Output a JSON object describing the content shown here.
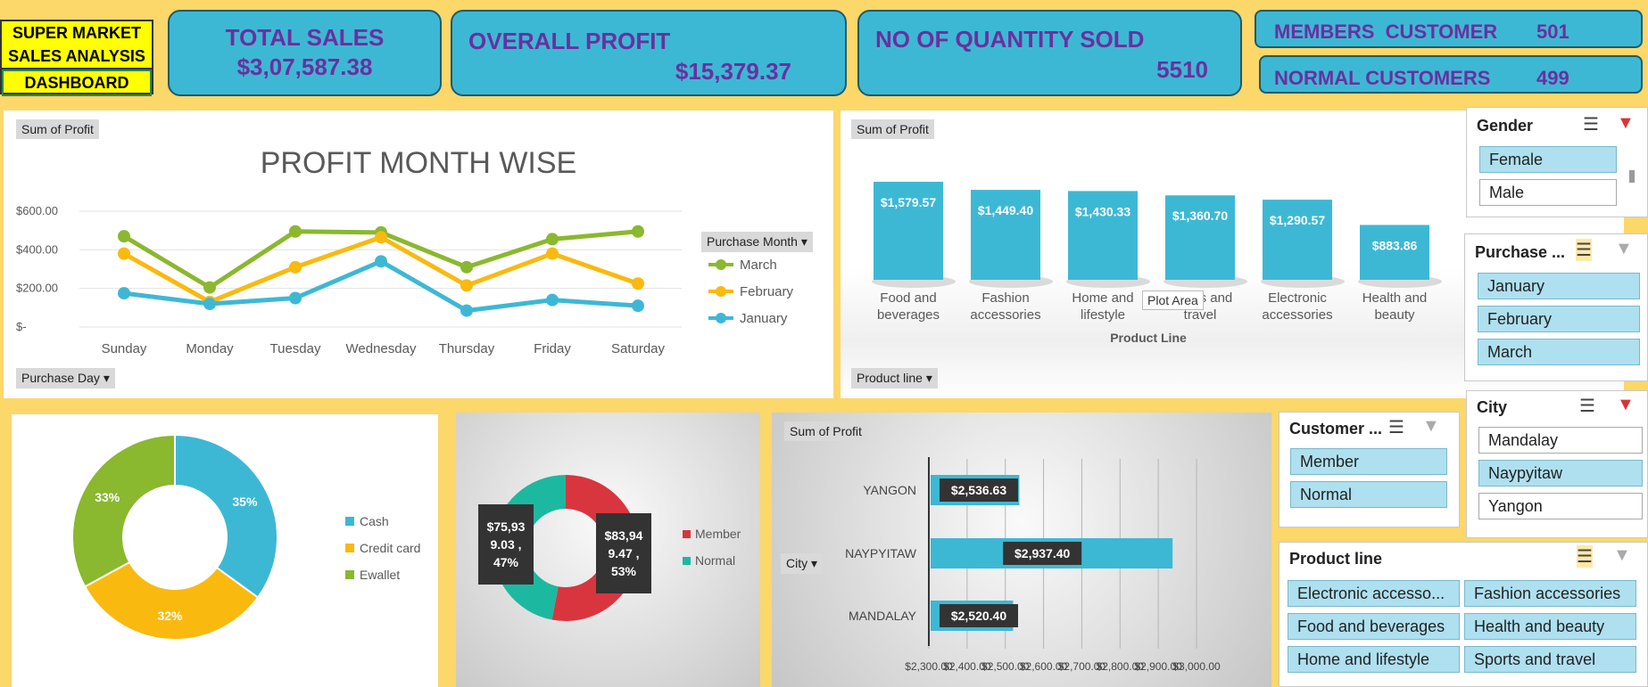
{
  "dashboard_title": [
    "SUPER MARKET",
    "SALES ANALYSIS",
    "DASHBOARD"
  ],
  "kpis": {
    "total_sales": {
      "label": "TOTAL SALES",
      "value": "$3,07,587.38"
    },
    "overall_profit": {
      "label": "OVERALL PROFIT",
      "value": "$15,379.37"
    },
    "qty_sold": {
      "label": "NO OF QUANTITY SOLD",
      "value": "5510"
    },
    "members": {
      "label": "MEMBERS  CUSTOMER",
      "value": "501"
    },
    "normal": {
      "label": "NORMAL CUSTOMERS",
      "value": "499"
    }
  },
  "colors": {
    "background": "#fcd76a",
    "accent": "#3db8d4",
    "kpi_text": "#6b2fa0",
    "march": "#8ab82e",
    "february": "#f9b90f",
    "january": "#3db8d4",
    "member": "#d9353f",
    "normal": "#1db8a0"
  },
  "chart_data": [
    {
      "type": "line",
      "title": "PROFIT MONTH WISE",
      "field_chip": "Sum of Profit",
      "axis_chip": "Purchase Day",
      "legend_title": "Purchase Month",
      "categories": [
        "Sunday",
        "Monday",
        "Tuesday",
        "Wednesday",
        "Thursday",
        "Friday",
        "Saturday"
      ],
      "y_ticks": [
        "$600.00",
        "$400.00",
        "$200.00",
        "$-"
      ],
      "ylim": [
        0,
        600
      ],
      "series": [
        {
          "name": "March",
          "values": [
            470,
            205,
            495,
            490,
            310,
            455,
            495
          ]
        },
        {
          "name": "February",
          "values": [
            380,
            130,
            310,
            465,
            215,
            380,
            225
          ]
        },
        {
          "name": "January",
          "values": [
            175,
            120,
            150,
            340,
            85,
            140,
            110
          ]
        }
      ]
    },
    {
      "type": "bar",
      "field_chip": "Sum of Profit",
      "axis_chip": "Product line",
      "xlabel": "Product Line",
      "tooltip": "Plot Area",
      "categories": [
        "Food and beverages",
        "Fashion accessories",
        "Home and lifestyle",
        "Sports and travel",
        "Electronic accessories",
        "Health and beauty"
      ],
      "labels": [
        "Food and\nbeverages",
        "Fashion\naccessories",
        "Home and\nlifestyle",
        "Sports and\ntravel",
        "Electronic\naccessories",
        "Health and\nbeauty"
      ],
      "values": [
        1579.57,
        1449.4,
        1430.33,
        1360.7,
        1290.57,
        883.86
      ],
      "data_labels": [
        "$1,579.57",
        "$1,449.40",
        "$1,430.33",
        "$1,360.70",
        "$1,290.57",
        "$883.86"
      ]
    },
    {
      "type": "pie",
      "categories": [
        "Cash",
        "Credit card",
        "Ewallet"
      ],
      "values": [
        35,
        32,
        33
      ],
      "data_labels": [
        "35%",
        "32%",
        "33%"
      ]
    },
    {
      "type": "pie",
      "categories": [
        "Member",
        "Normal"
      ],
      "values": [
        53,
        47
      ],
      "data_labels": [
        [
          "$83,94",
          "9.47 ,",
          "53%"
        ],
        [
          "$75,93",
          "9.03 ,",
          "47%"
        ]
      ]
    },
    {
      "type": "bar",
      "orientation": "horizontal",
      "field_chip": "Sum of Profit",
      "axis_chip": "City",
      "categories": [
        "YANGON",
        "NAYPYITAW",
        "MANDALAY"
      ],
      "values": [
        2536.63,
        2937.4,
        2520.4
      ],
      "data_labels": [
        "$2,536.63",
        "$2,937.40",
        "$2,520.40"
      ],
      "xlim": [
        2300,
        3000
      ],
      "x_ticks": [
        "$2,300.00",
        "$2,400.00",
        "$2,500.00",
        "$2,600.00",
        "$2,700.00",
        "$2,800.00",
        "$2,900.00",
        "$3,000.00"
      ]
    }
  ],
  "slicers": {
    "gender": {
      "title": "Gender",
      "items": [
        "Female",
        "Male"
      ],
      "selected": [
        "Female"
      ]
    },
    "purchase": {
      "title": "Purchase ...",
      "items": [
        "January",
        "February",
        "March"
      ]
    },
    "city": {
      "title": "City",
      "items": [
        "Mandalay",
        "Naypyitaw",
        "Yangon"
      ],
      "selected": [
        "Naypyitaw"
      ]
    },
    "customer": {
      "title": "Customer ...",
      "items": [
        "Member",
        "Normal"
      ]
    },
    "product_line": {
      "title": "Product line",
      "items": [
        "Electronic accesso...",
        "Fashion accessories",
        "Food and beverages",
        "Health and beauty",
        "Home and lifestyle",
        "Sports and travel"
      ]
    }
  }
}
